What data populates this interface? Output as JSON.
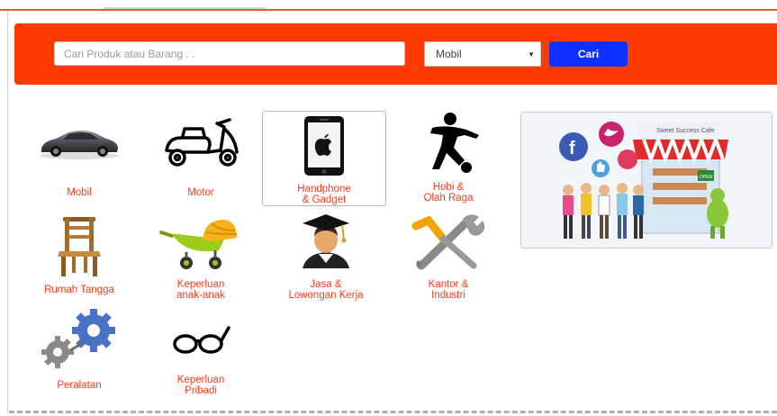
{
  "search": {
    "placeholder": "Cari Produk atau Barang . .",
    "category_selected": "Mobil",
    "button_label": "Cari"
  },
  "categories": [
    {
      "label": "Mobil",
      "icon": "car-icon"
    },
    {
      "label": "Motor",
      "icon": "scooter-icon"
    },
    {
      "label": "Handphone\n& Gadget",
      "icon": "smartphone-icon",
      "selected": true
    },
    {
      "label": "Hobi &\nOlah Raga",
      "icon": "soccer-player-icon"
    },
    {
      "label": "Rumah Tangga",
      "icon": "chair-icon"
    },
    {
      "label": "Keperluan\nanak-anak",
      "icon": "stroller-icon"
    },
    {
      "label": "Jasa &\nLowongan Kerja",
      "icon": "graduate-icon"
    },
    {
      "label": "Kantor &\nIndustri",
      "icon": "tools-icon"
    },
    {
      "label": "Peralatan",
      "icon": "gears-icon"
    },
    {
      "label": "Keperluan\nPribadi",
      "icon": "glasses-icon"
    }
  ],
  "banner": {
    "sign_text": "Sweet Success Cafe",
    "door_text": "OPEN",
    "icons": [
      "facebook-icon",
      "twitter-icon",
      "thumbs-up-icon",
      "chat-bubble-icon"
    ]
  },
  "colors": {
    "accent": "#ff3a00",
    "button": "#1030ff",
    "label": "#ff3a1a"
  }
}
